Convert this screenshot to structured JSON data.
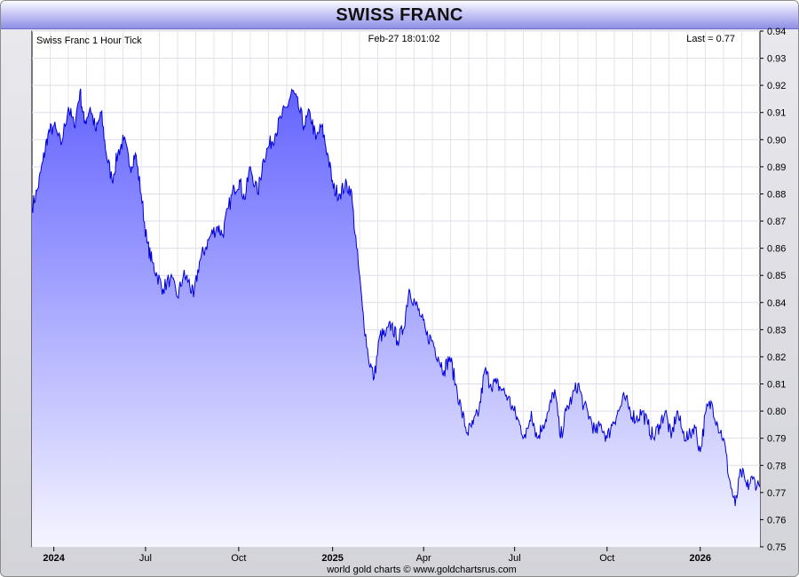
{
  "title": "SWISS FRANC",
  "chart_data": {
    "type": "area",
    "title": "SWISS FRANC",
    "subtitle": "Swiss Franc 1 Hour Tick",
    "timestamp": "Feb-27  18:01:02",
    "last_label": "Last = 0.77",
    "footer": "world gold charts © www.goldchartsrus.com",
    "ylim": [
      0.75,
      0.94
    ],
    "yticks": [
      "0.94",
      "0.93",
      "0.92",
      "0.91",
      "0.90",
      "0.89",
      "0.88",
      "0.87",
      "0.86",
      "0.85",
      "0.84",
      "0.83",
      "0.82",
      "0.81",
      "0.80",
      "0.79",
      "0.78",
      "0.77",
      "0.76",
      "0.75"
    ],
    "xticks": [
      {
        "label": "2024",
        "t": 0.03,
        "bold": true
      },
      {
        "label": "Jul",
        "t": 0.156,
        "bold": false
      },
      {
        "label": "Oct",
        "t": 0.284,
        "bold": false
      },
      {
        "label": "2025",
        "t": 0.413,
        "bold": true
      },
      {
        "label": "Apr",
        "t": 0.538,
        "bold": false
      },
      {
        "label": "Jul",
        "t": 0.663,
        "bold": false
      },
      {
        "label": "Oct",
        "t": 0.79,
        "bold": false
      },
      {
        "label": "2026",
        "t": 0.918,
        "bold": true
      }
    ],
    "grid": true,
    "series": [
      {
        "color": "#0000dd",
        "t": [
          0.0,
          0.008,
          0.015,
          0.022,
          0.03,
          0.04,
          0.05,
          0.058,
          0.066,
          0.072,
          0.08,
          0.088,
          0.095,
          0.102,
          0.11,
          0.118,
          0.126,
          0.135,
          0.142,
          0.15,
          0.158,
          0.165,
          0.172,
          0.18,
          0.19,
          0.2,
          0.208,
          0.215,
          0.222,
          0.23,
          0.238,
          0.246,
          0.255,
          0.262,
          0.27,
          0.278,
          0.285,
          0.292,
          0.3,
          0.31,
          0.318,
          0.326,
          0.334,
          0.342,
          0.35,
          0.358,
          0.366,
          0.374,
          0.382,
          0.39,
          0.398,
          0.406,
          0.414,
          0.422,
          0.43,
          0.438,
          0.446,
          0.454,
          0.462,
          0.47,
          0.478,
          0.486,
          0.494,
          0.502,
          0.51,
          0.518,
          0.526,
          0.534,
          0.542,
          0.55,
          0.558,
          0.566,
          0.574,
          0.582,
          0.59,
          0.598,
          0.606,
          0.614,
          0.622,
          0.63,
          0.638,
          0.646,
          0.654,
          0.662,
          0.67,
          0.678,
          0.686,
          0.694,
          0.702,
          0.71,
          0.718,
          0.726,
          0.734,
          0.742,
          0.75,
          0.758,
          0.766,
          0.774,
          0.782,
          0.79,
          0.798,
          0.806,
          0.814,
          0.822,
          0.83,
          0.838,
          0.846,
          0.854,
          0.862,
          0.87,
          0.878,
          0.886,
          0.894,
          0.902,
          0.91,
          0.918,
          0.926,
          0.934,
          0.942,
          0.95,
          0.958,
          0.966,
          0.974,
          0.982,
          0.99,
          1.0
        ],
        "values": [
          0.875,
          0.882,
          0.892,
          0.902,
          0.905,
          0.898,
          0.912,
          0.905,
          0.918,
          0.906,
          0.912,
          0.903,
          0.91,
          0.895,
          0.885,
          0.895,
          0.9,
          0.89,
          0.895,
          0.88,
          0.862,
          0.855,
          0.85,
          0.845,
          0.849,
          0.842,
          0.85,
          0.848,
          0.842,
          0.855,
          0.86,
          0.865,
          0.868,
          0.865,
          0.875,
          0.882,
          0.885,
          0.878,
          0.89,
          0.88,
          0.893,
          0.898,
          0.902,
          0.908,
          0.912,
          0.918,
          0.912,
          0.905,
          0.91,
          0.9,
          0.905,
          0.895,
          0.882,
          0.88,
          0.883,
          0.882,
          0.86,
          0.838,
          0.82,
          0.812,
          0.828,
          0.828,
          0.832,
          0.826,
          0.83,
          0.845,
          0.84,
          0.835,
          0.828,
          0.826,
          0.82,
          0.815,
          0.82,
          0.81,
          0.8,
          0.792,
          0.795,
          0.8,
          0.815,
          0.81,
          0.81,
          0.808,
          0.805,
          0.8,
          0.795,
          0.79,
          0.8,
          0.79,
          0.795,
          0.8,
          0.808,
          0.79,
          0.8,
          0.805,
          0.81,
          0.802,
          0.798,
          0.792,
          0.795,
          0.79,
          0.796,
          0.8,
          0.805,
          0.8,
          0.797,
          0.8,
          0.795,
          0.79,
          0.795,
          0.8,
          0.79,
          0.8,
          0.792,
          0.79,
          0.795,
          0.785,
          0.8,
          0.803,
          0.795,
          0.79,
          0.775,
          0.765,
          0.778,
          0.772,
          0.775,
          0.772
        ]
      }
    ]
  }
}
